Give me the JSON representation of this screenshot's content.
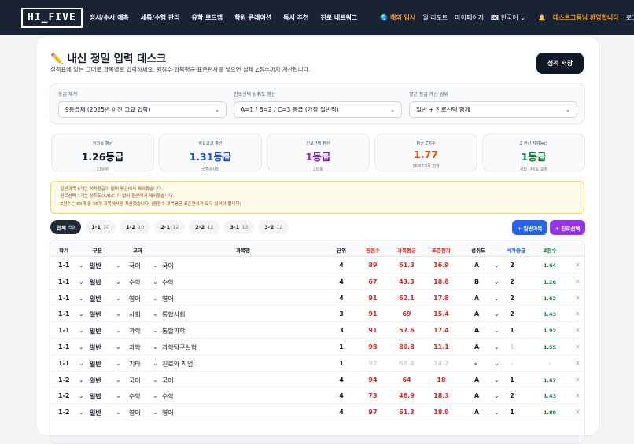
{
  "nav": {
    "logo": "HI_FIVE",
    "items": [
      "정시/수시 예측",
      "세특/수행 관리",
      "유학 로드맵",
      "학원 큐레이션",
      "독서 추천",
      "진로 네트워크"
    ],
    "overseas": "해외 입시",
    "report": "월 리포트",
    "mypage": "마이페이지",
    "lang": "한국어",
    "welcome": "테스트고등님 환영합니다",
    "logout": "로그아웃"
  },
  "header": {
    "title": "내신 정밀 입력 데스크",
    "subtitle": "성적표에 있는 그대로 과목별로 입력하세요. 원점수·과목평균·표준편차를 넣으면 실제 Z점수까지 계산됩니다.",
    "save_label": "성적 저장"
  },
  "settings": [
    {
      "label": "등급 체계",
      "value": "9등급제 (2025년 이전 고교 입학)"
    },
    {
      "label": "진로선택 성취도 환산",
      "value": "A=1 / B=2 / C=3 등급 (가장 일반적)"
    },
    {
      "label": "평균 등급 계산 범위",
      "value": "일반 + 진로선택 함께"
    }
  ],
  "stats": [
    {
      "label": "전과목 평균",
      "value": "1.26등급",
      "sub": "17단위",
      "color": "#111827"
    },
    {
      "label": "주요교과 평균",
      "value": "1.31등급",
      "sub": "국영수사과",
      "color": "#1d4ed8"
    },
    {
      "label": "진로선택 환산",
      "value": "1등급",
      "sub": "2과목",
      "color": "#7e22ce"
    },
    {
      "label": "평균 Z점수",
      "value": "1.77",
      "sub": "36/69과목 반영",
      "color": "#ea580c"
    },
    {
      "label": "Z 환산 체감등급",
      "value": "1등급",
      "sub": "시험 난이도 보정",
      "color": "#15803d"
    }
  ],
  "notices": [
    "· 일반과목 6개는 석차등급이 없어 평균에서 제외했습니다.",
    "· 진로선택 1개는 성취도(A/B/C)가 없어 환산에서 제외했습니다.",
    "· Z점수는 69개 중 36개 과목에서만 계산했습니다. (원점수·과목평균·표준편차가 모두 있어야 합니다)"
  ],
  "filters": [
    {
      "label": "전체",
      "count": "69"
    },
    {
      "label": "1-1",
      "count": "10"
    },
    {
      "label": "1-2",
      "count": "10"
    },
    {
      "label": "2-1",
      "count": "12"
    },
    {
      "label": "2-2",
      "count": "12"
    },
    {
      "label": "3-1",
      "count": "13"
    },
    {
      "label": "3-2",
      "count": "12"
    }
  ],
  "add_general": "+ 일반과목",
  "add_career": "+ 진로선택",
  "columns": [
    "학기",
    "구분",
    "교과",
    "과목명",
    "단위",
    "원점수",
    "과목평균",
    "표준편차",
    "성취도",
    "석차등급",
    "Z점수"
  ],
  "rows": [
    {
      "sem": "1-1",
      "type": "일반",
      "area": "국어",
      "name": "국어",
      "unit": "4",
      "raw": "89",
      "avg": "61.3",
      "std": "16.9",
      "ach": "A",
      "rank": "2",
      "z": "1.64"
    },
    {
      "sem": "1-1",
      "type": "일반",
      "area": "수학",
      "name": "수학",
      "unit": "4",
      "raw": "67",
      "avg": "43.3",
      "std": "18.8",
      "ach": "B",
      "rank": "2",
      "z": "1.26"
    },
    {
      "sem": "1-1",
      "type": "일반",
      "area": "영어",
      "name": "영어",
      "unit": "4",
      "raw": "91",
      "avg": "62.1",
      "std": "17.8",
      "ach": "A",
      "rank": "2",
      "z": "1.62"
    },
    {
      "sem": "1-1",
      "type": "일반",
      "area": "사회",
      "name": "통합사회",
      "unit": "3",
      "raw": "91",
      "avg": "69",
      "std": "15.4",
      "ach": "A",
      "rank": "2",
      "z": "1.43"
    },
    {
      "sem": "1-1",
      "type": "일반",
      "area": "과학",
      "name": "통합과학",
      "unit": "3",
      "raw": "91",
      "avg": "57.6",
      "std": "17.4",
      "ach": "A",
      "rank": "1",
      "z": "1.92"
    },
    {
      "sem": "1-1",
      "type": "일반",
      "area": "과학",
      "name": "과학탐구실험",
      "unit": "1",
      "raw": "98",
      "avg": "80.8",
      "std": "11.1",
      "ach": "A",
      "rank": "1",
      "z": "1.55",
      "rank_dim": true
    },
    {
      "sem": "1-1",
      "type": "일반",
      "area": "기타",
      "name": "진로와 직업",
      "unit": "1",
      "raw": "92",
      "avg": "68.4",
      "std": "14.2",
      "ach": "-",
      "rank": "-",
      "z": "-",
      "dim": true
    },
    {
      "sem": "1-2",
      "type": "일반",
      "area": "국어",
      "name": "국어",
      "unit": "4",
      "raw": "94",
      "avg": "64",
      "std": "18",
      "ach": "A",
      "rank": "1",
      "z": "1.67"
    },
    {
      "sem": "1-2",
      "type": "일반",
      "area": "수학",
      "name": "수학",
      "unit": "4",
      "raw": "73",
      "avg": "46.9",
      "std": "18.3",
      "ach": "A",
      "rank": "2",
      "z": "1.43"
    },
    {
      "sem": "1-2",
      "type": "일반",
      "area": "영어",
      "name": "영어",
      "unit": "4",
      "raw": "97",
      "avg": "61.3",
      "std": "18.9",
      "ach": "A",
      "rank": "1",
      "z": "1.89"
    }
  ]
}
